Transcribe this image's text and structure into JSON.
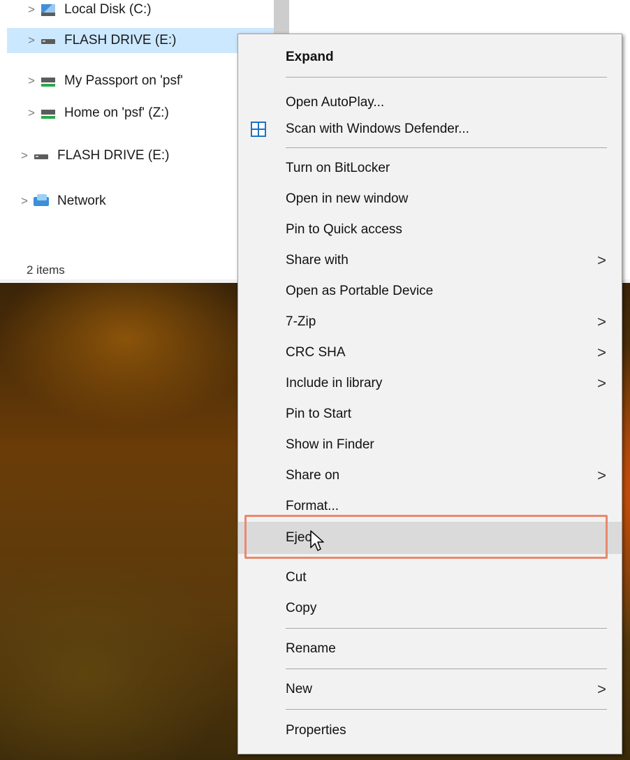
{
  "explorer": {
    "tree": [
      {
        "label": "Local Disk (C:)",
        "icon": "local-disk-icon",
        "selected": false
      },
      {
        "label": "FLASH DRIVE (E:)",
        "icon": "usb-drive-icon",
        "selected": true
      },
      {
        "label": "My Passport on 'psf'",
        "icon": "network-drive-icon",
        "selected": false
      },
      {
        "label": "Home on 'psf' (Z:)",
        "icon": "network-drive-icon",
        "selected": false
      },
      {
        "label": "FLASH DRIVE (E:)",
        "icon": "usb-drive-icon",
        "selected": false
      },
      {
        "label": "Network",
        "icon": "network-icon",
        "selected": false
      }
    ],
    "status": "2 items"
  },
  "context_menu": {
    "items": [
      {
        "label": "Expand",
        "bold": true
      },
      {
        "label": "Open AutoPlay..."
      },
      {
        "label": "Scan with Windows Defender...",
        "icon": "windows-defender-icon"
      },
      {
        "label": "Turn on BitLocker"
      },
      {
        "label": "Open in new window"
      },
      {
        "label": "Pin to Quick access"
      },
      {
        "label": "Share with",
        "submenu": true
      },
      {
        "label": "Open as Portable Device"
      },
      {
        "label": "7-Zip",
        "submenu": true
      },
      {
        "label": "CRC SHA",
        "submenu": true
      },
      {
        "label": "Include in library",
        "submenu": true
      },
      {
        "label": "Pin to Start"
      },
      {
        "label": "Show in Finder"
      },
      {
        "label": "Share on",
        "submenu": true
      },
      {
        "label": "Format..."
      },
      {
        "label": "Eject",
        "hovered": true
      },
      {
        "label": "Cut"
      },
      {
        "label": "Copy"
      },
      {
        "label": "Rename"
      },
      {
        "label": "New",
        "submenu": true
      },
      {
        "label": "Properties"
      }
    ],
    "submenu_glyph": ">",
    "highlight_color": "#e8896e",
    "hover_color": "#dadada"
  },
  "colors": {
    "selection": "#cce8ff",
    "menu_background": "#f2f2f2"
  }
}
